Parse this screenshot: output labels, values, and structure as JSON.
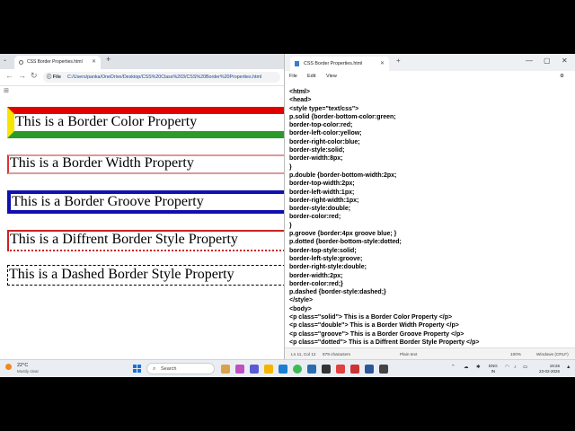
{
  "browser": {
    "tab_title": "CSS Border Properties.html",
    "address_file_chip": "File",
    "url": "C:/Users/panka/OneDrive/Desktop/CSS%20Class%203/CSS%20Border%20Properties.html",
    "paragraphs": {
      "solid": "This is a Border Color Property",
      "double": "This is a Border Width Property",
      "groove": "This is a Border Groove Property",
      "dotted": "This is a Diffrent Border Style Property",
      "dashed": "This is a Dashed Border Style Property"
    }
  },
  "notepad": {
    "tab_title": "CSS Border Properties.html",
    "menu": [
      "File",
      "Edit",
      "View"
    ],
    "code_lines": [
      "<html>",
      "<head>",
      "<style type=\"text/css\">",
      "p.solid {border-bottom-color:green;",
      "border-top-color:red;",
      "border-left-color:yellow;",
      "border-right-color:blue;",
      "border-style:solid;",
      "border-width:8px;",
      "}",
      "p.double {border-bottom-width:2px;",
      "border-top-width:2px;",
      "border-left-width:1px;",
      "border-right-width:1px;",
      "border-style:double;",
      "border-color:red;",
      "}",
      "p.groove {border:4px groove blue; }",
      "p.dotted {border-bottom-style:dotted;",
      "border-top-style:solid;",
      "border-left-style:groove;",
      "border-right-style:double;",
      "border-width:2px;",
      "border-color:red;}",
      "p.dashed {border-style:dashed;}",
      "</style>",
      "<body>",
      "<p class=\"solid\"> This is a Border Color Property </p>",
      "<p class=\"double\"> This is a Border Width Property </p>",
      "<p class=\"groove\"> This is a Border Groove Property </p>",
      "<p class=\"dotted\"> This is a Diffrent Border Style Property </p>"
    ],
    "status": {
      "position": "Ln 11, Col 12",
      "chars": "879 characters",
      "format": "Plain text",
      "zoom": "100%",
      "eol": "Windows (CRLF)"
    }
  },
  "taskbar": {
    "temperature": "22°C",
    "weather": "Mostly clear",
    "search_placeholder": "Search",
    "lang_line1": "ENG",
    "lang_line2": "IN",
    "time": "19:26",
    "date": "23-02-2026"
  },
  "colors": {
    "accent": "#1c72d6",
    "taskbar_bg": "#eaeef2"
  }
}
